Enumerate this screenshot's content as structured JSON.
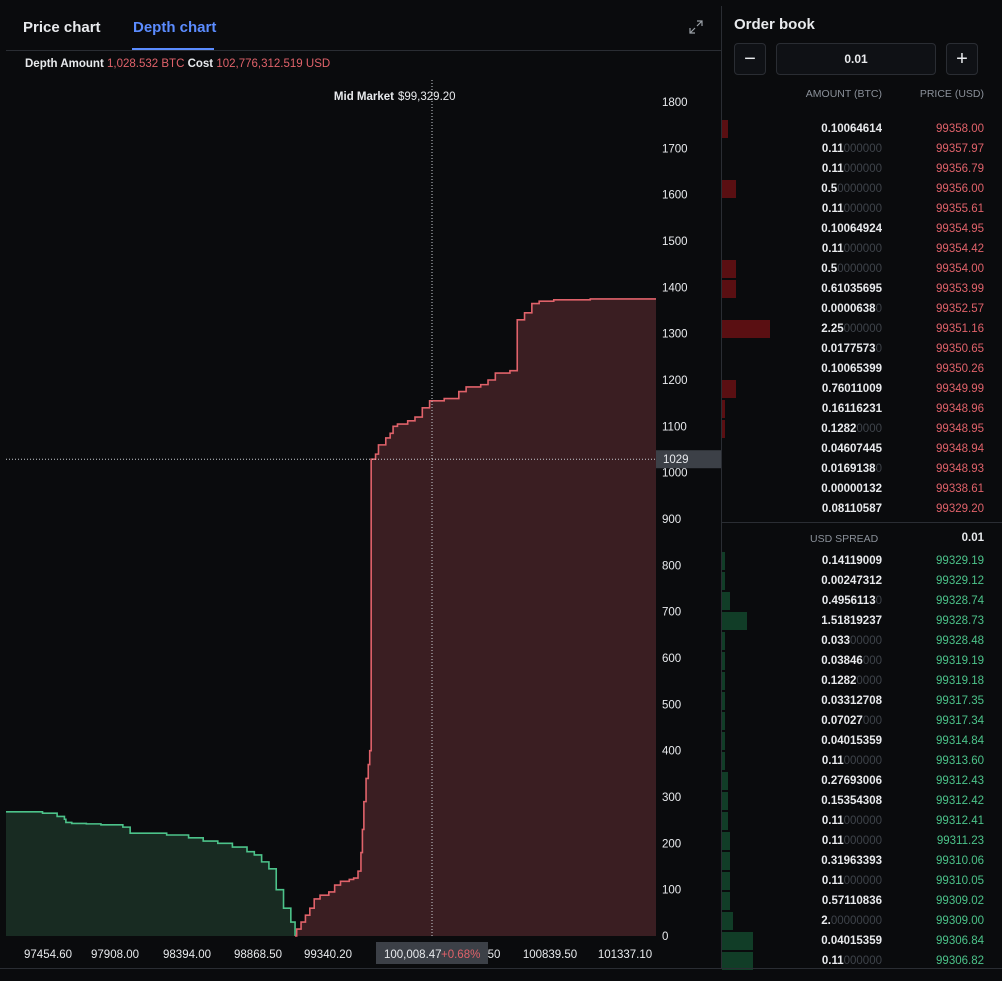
{
  "tabs": [
    {
      "label": "Price chart",
      "active": false
    },
    {
      "label": "Depth chart",
      "active": true
    }
  ],
  "depth_info": {
    "amount_label": "Depth Amount",
    "amount_value": "1,028.532",
    "amount_unit": "BTC",
    "cost_label": "Cost",
    "cost_value": "102,776,312.519",
    "cost_unit": "USD"
  },
  "chart_data": {
    "type": "area",
    "mid_market_label": "Mid Market",
    "mid_market_value": "$99,329.20",
    "ylim": [
      0,
      1800
    ],
    "y_ticks": [
      0,
      100,
      200,
      300,
      400,
      500,
      600,
      700,
      800,
      900,
      1000,
      1100,
      1200,
      1300,
      1400,
      1500,
      1600,
      1700,
      1800
    ],
    "x_tick_labels": [
      "97454.60",
      "97908.00",
      "98394.00",
      "98868.50",
      "99340.20",
      "100,008.47",
      "100839.50",
      "101337.10"
    ],
    "x_tick_hidden_suffix": "50",
    "crosshair_value": "1029",
    "crosshair_price": "100,008.47",
    "crosshair_change": "+0.68%",
    "xlim": [
      97350,
      101800
    ],
    "series": [
      {
        "side": "bid",
        "color": "#4cc38a",
        "points": [
          [
            97350,
            268
          ],
          [
            97600,
            265
          ],
          [
            97700,
            258
          ],
          [
            97750,
            252
          ],
          [
            97760,
            245
          ],
          [
            97800,
            243
          ],
          [
            97900,
            242
          ],
          [
            98000,
            240
          ],
          [
            98150,
            235
          ],
          [
            98200,
            230
          ],
          [
            98200,
            222
          ],
          [
            98450,
            218
          ],
          [
            98600,
            212
          ],
          [
            98700,
            205
          ],
          [
            98800,
            200
          ],
          [
            98900,
            192
          ],
          [
            99000,
            182
          ],
          [
            99050,
            175
          ],
          [
            99100,
            160
          ],
          [
            99150,
            145
          ],
          [
            99200,
            100
          ],
          [
            99250,
            60
          ],
          [
            99300,
            30
          ],
          [
            99329,
            0
          ]
        ]
      },
      {
        "side": "ask",
        "color": "#e0626a",
        "points": [
          [
            99329,
            0
          ],
          [
            99340,
            15
          ],
          [
            99370,
            30
          ],
          [
            99400,
            45
          ],
          [
            99430,
            60
          ],
          [
            99460,
            80
          ],
          [
            99500,
            88
          ],
          [
            99560,
            95
          ],
          [
            99600,
            110
          ],
          [
            99640,
            118
          ],
          [
            99700,
            122
          ],
          [
            99730,
            125
          ],
          [
            99760,
            140
          ],
          [
            99780,
            180
          ],
          [
            99790,
            230
          ],
          [
            99800,
            290
          ],
          [
            99815,
            340
          ],
          [
            99830,
            370
          ],
          [
            99840,
            400
          ],
          [
            99850,
            1029
          ],
          [
            99880,
            1040
          ],
          [
            99900,
            1060
          ],
          [
            99950,
            1075
          ],
          [
            99980,
            1085
          ],
          [
            100000,
            1100
          ],
          [
            100030,
            1105
          ],
          [
            100100,
            1112
          ],
          [
            100150,
            1120
          ],
          [
            100200,
            1140
          ],
          [
            100250,
            1155
          ],
          [
            100350,
            1160
          ],
          [
            100450,
            1175
          ],
          [
            100500,
            1185
          ],
          [
            100600,
            1190
          ],
          [
            100650,
            1200
          ],
          [
            100700,
            1215
          ],
          [
            100800,
            1220
          ],
          [
            100850,
            1330
          ],
          [
            100900,
            1345
          ],
          [
            100950,
            1365
          ],
          [
            101000,
            1370
          ],
          [
            101100,
            1373
          ],
          [
            101350,
            1375
          ]
        ]
      }
    ]
  },
  "order_book": {
    "title": "Order book",
    "minus": "−",
    "plus": "+",
    "increment": "0.01",
    "col_amount": "AMOUNT (BTC)",
    "col_price": "PRICE (USD)",
    "spread_label": "USD SPREAD",
    "spread_value": "0.01",
    "asks": [
      {
        "amt": "0.10064614",
        "pad": "",
        "price": "99358.00",
        "depth": 0.02
      },
      {
        "amt": "0.11",
        "pad": "000000",
        "price": "99357.97",
        "depth": 0.0
      },
      {
        "amt": "0.11",
        "pad": "000000",
        "price": "99356.79",
        "depth": 0.0
      },
      {
        "amt": "0.5",
        "pad": "0000000",
        "price": "99356.00",
        "depth": 0.05
      },
      {
        "amt": "0.11",
        "pad": "000000",
        "price": "99355.61",
        "depth": 0.0
      },
      {
        "amt": "0.10064924",
        "pad": "",
        "price": "99354.95",
        "depth": 0.0
      },
      {
        "amt": "0.11",
        "pad": "000000",
        "price": "99354.42",
        "depth": 0.0
      },
      {
        "amt": "0.5",
        "pad": "0000000",
        "price": "99354.00",
        "depth": 0.05
      },
      {
        "amt": "0.61035695",
        "pad": "",
        "price": "99353.99",
        "depth": 0.05
      },
      {
        "amt": "0.0000638",
        "pad": "0",
        "price": "99352.57",
        "depth": 0.0
      },
      {
        "amt": "2.25",
        "pad": "000000",
        "price": "99351.16",
        "depth": 0.17
      },
      {
        "amt": "0.0177573",
        "pad": "0",
        "price": "99350.65",
        "depth": 0.0
      },
      {
        "amt": "0.10065399",
        "pad": "",
        "price": "99350.26",
        "depth": 0.0
      },
      {
        "amt": "0.76011009",
        "pad": "",
        "price": "99349.99",
        "depth": 0.05
      },
      {
        "amt": "0.16116231",
        "pad": "",
        "price": "99348.96",
        "depth": 0.01
      },
      {
        "amt": "0.1282",
        "pad": "0000",
        "price": "99348.95",
        "depth": 0.01
      },
      {
        "amt": "0.04607445",
        "pad": "",
        "price": "99348.94",
        "depth": 0.0
      },
      {
        "amt": "0.0169138",
        "pad": "0",
        "price": "99348.93",
        "depth": 0.0
      },
      {
        "amt": "0.00000132",
        "pad": "",
        "price": "99338.61",
        "depth": 0.0
      },
      {
        "amt": "0.08110587",
        "pad": "",
        "price": "99329.20",
        "depth": 0.0
      }
    ],
    "bids": [
      {
        "amt": "0.14119009",
        "pad": "",
        "price": "99329.19",
        "depth": 0.01
      },
      {
        "amt": "0.00247312",
        "pad": "",
        "price": "99329.12",
        "depth": 0.01
      },
      {
        "amt": "0.4956113",
        "pad": "0",
        "price": "99328.74",
        "depth": 0.03
      },
      {
        "amt": "1.51819237",
        "pad": "",
        "price": "99328.73",
        "depth": 0.09
      },
      {
        "amt": "0.033",
        "pad": "00000",
        "price": "99328.48",
        "depth": 0.01
      },
      {
        "amt": "0.03846",
        "pad": "000",
        "price": "99319.19",
        "depth": 0.01
      },
      {
        "amt": "0.1282",
        "pad": "0000",
        "price": "99319.18",
        "depth": 0.01
      },
      {
        "amt": "0.03312708",
        "pad": "",
        "price": "99317.35",
        "depth": 0.01
      },
      {
        "amt": "0.07027",
        "pad": "000",
        "price": "99317.34",
        "depth": 0.01
      },
      {
        "amt": "0.04015359",
        "pad": "",
        "price": "99314.84",
        "depth": 0.01
      },
      {
        "amt": "0.11",
        "pad": "000000",
        "price": "99313.60",
        "depth": 0.01
      },
      {
        "amt": "0.27693006",
        "pad": "",
        "price": "99312.43",
        "depth": 0.02
      },
      {
        "amt": "0.15354308",
        "pad": "",
        "price": "99312.42",
        "depth": 0.02
      },
      {
        "amt": "0.11",
        "pad": "000000",
        "price": "99312.41",
        "depth": 0.02
      },
      {
        "amt": "0.11",
        "pad": "000000",
        "price": "99311.23",
        "depth": 0.03
      },
      {
        "amt": "0.31963393",
        "pad": "",
        "price": "99310.06",
        "depth": 0.03
      },
      {
        "amt": "0.11",
        "pad": "000000",
        "price": "99310.05",
        "depth": 0.03
      },
      {
        "amt": "0.57110836",
        "pad": "",
        "price": "99309.02",
        "depth": 0.03
      },
      {
        "amt": "2.",
        "pad": "00000000",
        "price": "99309.00",
        "depth": 0.04
      },
      {
        "amt": "0.04015359",
        "pad": "",
        "price": "99306.84",
        "depth": 0.11
      },
      {
        "amt": "0.11",
        "pad": "000000",
        "price": "99306.82",
        "depth": 0.11
      }
    ]
  },
  "colors": {
    "ask": "#e0626a",
    "bid": "#4cc38a",
    "ask_fill": "#3a1e22",
    "bid_fill": "#182b22",
    "ask_bar": "#5a0f12",
    "bid_bar": "#113d27",
    "accent": "#5b8cff"
  }
}
